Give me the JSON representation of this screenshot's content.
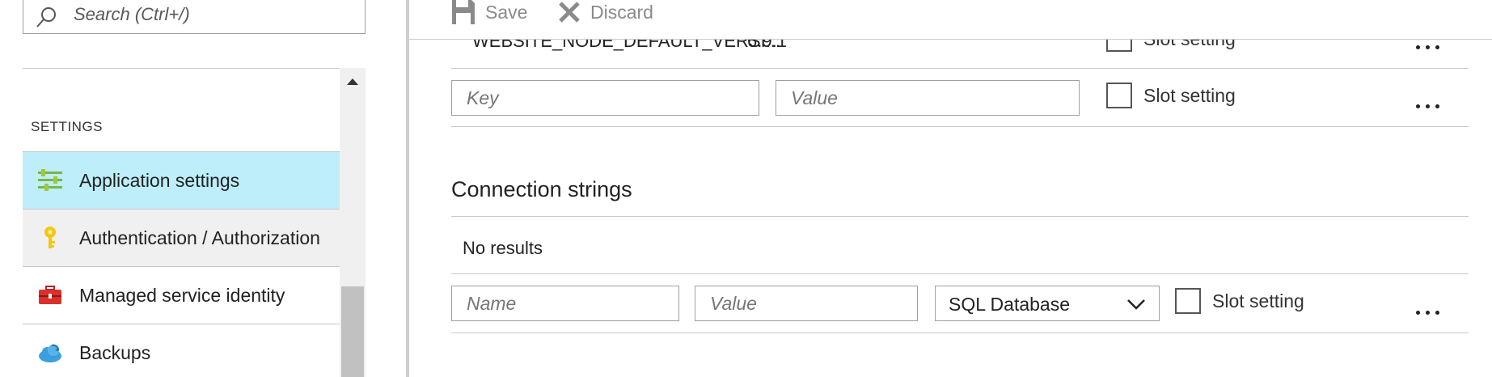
{
  "search": {
    "placeholder": "Search (Ctrl+/)"
  },
  "sidebar": {
    "section_label": "SETTINGS",
    "items": [
      {
        "label": "Application settings",
        "icon": "sliders-icon",
        "state": "selected"
      },
      {
        "label": "Authentication / Authorization",
        "icon": "key-icon",
        "state": "hovered"
      },
      {
        "label": "Managed service identity",
        "icon": "toolbox-icon",
        "state": "normal"
      },
      {
        "label": "Backups",
        "icon": "cloud-backup-icon",
        "state": "normal"
      }
    ]
  },
  "toolbar": {
    "save_label": "Save",
    "discard_label": "Discard"
  },
  "app_settings": {
    "rows": [
      {
        "key": "WEBSITE_NODE_DEFAULT_VERSI...",
        "value": "6.9.1",
        "slot_label": "Slot setting"
      }
    ],
    "new_row": {
      "key_placeholder": "Key",
      "value_placeholder": "Value",
      "slot_label": "Slot setting"
    }
  },
  "connection_strings": {
    "title": "Connection strings",
    "empty_text": "No results",
    "new_row": {
      "name_placeholder": "Name",
      "value_placeholder": "Value",
      "type_value": "SQL Database",
      "slot_label": "Slot setting"
    }
  },
  "colors": {
    "selected_item": "#bdeefa",
    "hover_item": "#f0f0f0",
    "border": "#c8c8c8",
    "toolbar_disabled": "#8a8a8a"
  }
}
